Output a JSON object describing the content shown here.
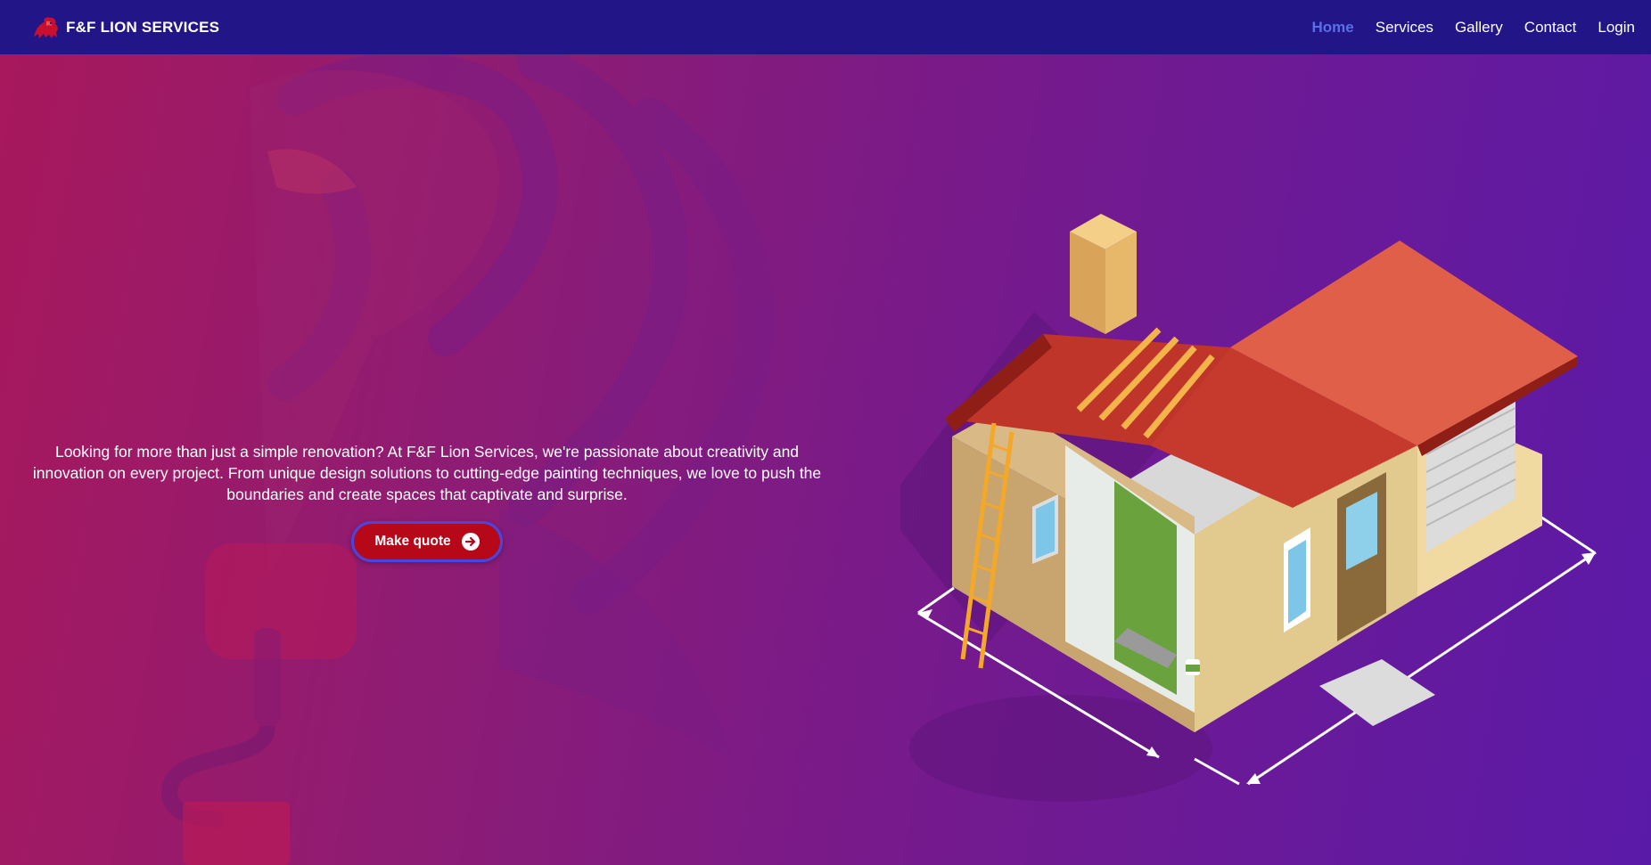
{
  "brand": {
    "name": "F&F LION SERVICES",
    "logo_icon": "lion-logo-icon"
  },
  "nav": {
    "items": [
      {
        "label": "Home",
        "active": true
      },
      {
        "label": "Services",
        "active": false
      },
      {
        "label": "Gallery",
        "active": false
      },
      {
        "label": "Contact",
        "active": false
      },
      {
        "label": "Login",
        "active": false
      }
    ]
  },
  "hero": {
    "description": "Looking for more than just a simple renovation? At F&F Lion Services, we're passionate about creativity and innovation on every project. From unique design solutions to cutting-edge painting techniques, we love to push the boundaries and create spaces that captivate and surprise.",
    "cta_label": "Make quote",
    "cta_icon": "arrow-right-circle-icon",
    "illustration": "isometric-house-renovation-illustration"
  },
  "colors": {
    "navbar": "#221588",
    "active_nav": "#5b6fe4",
    "cta_background": "#b7081a",
    "cta_border": "#4a45e0"
  }
}
